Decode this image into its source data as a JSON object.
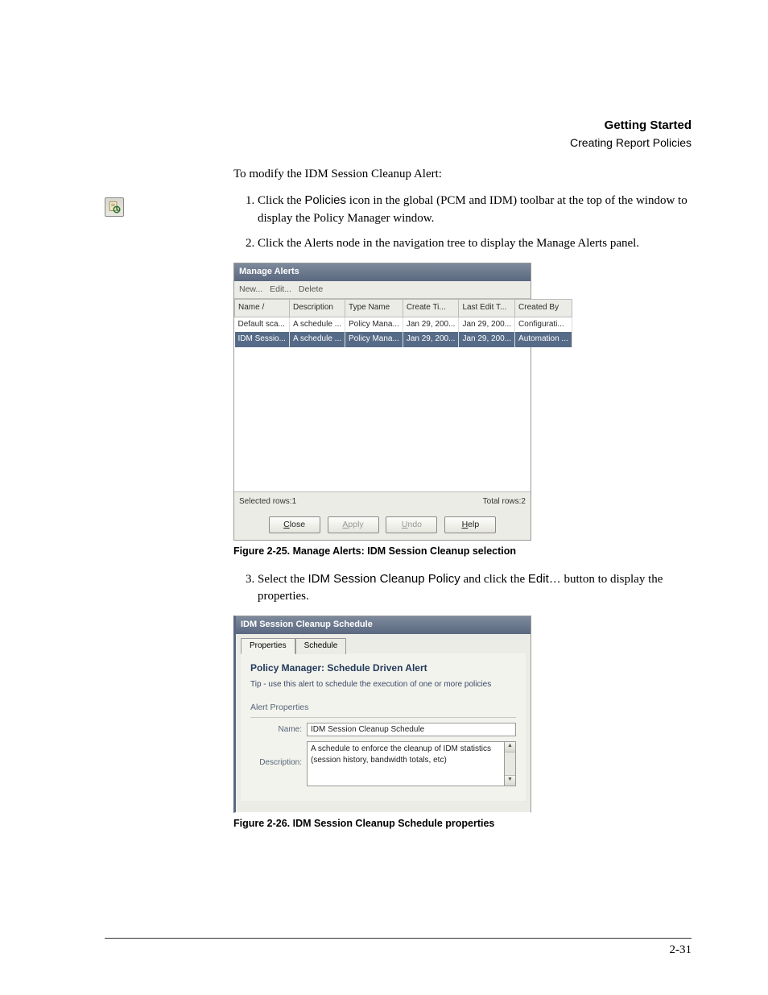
{
  "header": {
    "title": "Getting Started",
    "subtitle": "Creating Report Policies"
  },
  "intro": "To modify the IDM Session Cleanup Alert:",
  "step1_pre": "Click the ",
  "step1_term": "Policies",
  "step1_post": " icon in the global (PCM and IDM) toolbar at the top of the window to display the Policy Manager window.",
  "step2": "Click the Alerts node in the navigation tree to display the Manage Alerts panel.",
  "manage_alerts": {
    "title": "Manage Alerts",
    "menu": [
      "New...",
      "Edit...",
      "Delete"
    ],
    "headers": [
      "Name  /",
      "Description",
      "Type Name",
      "Create Ti...",
      "Last Edit T...",
      "Created By"
    ],
    "rows": [
      [
        "Default sca...",
        "A schedule ...",
        "Policy Mana...",
        "Jan 29, 200...",
        "Jan 29, 200...",
        "Configurati..."
      ],
      [
        "IDM Sessio...",
        "A schedule ...",
        "Policy Mana...",
        "Jan 29, 200...",
        "Jan 29, 200...",
        "Automation ..."
      ]
    ],
    "selected_rows": "Selected rows:1",
    "total_rows": "Total rows:2",
    "buttons": {
      "close": "Close",
      "apply": "Apply",
      "undo": "Undo",
      "help": "Help"
    }
  },
  "fig1_caption": "Figure 2-25. Manage Alerts: IDM Session Cleanup selection",
  "step3_pre": "Select the ",
  "step3_term": "IDM Session Cleanup Policy",
  "step3_mid": " and click the ",
  "step3_btn": "Edit…",
  "step3_post": " button to display the properties.",
  "schedule_dialog": {
    "title": "IDM Session Cleanup Schedule",
    "tabs": {
      "properties": "Properties",
      "schedule": "Schedule"
    },
    "heading": "Policy Manager: Schedule Driven Alert",
    "tip": "Tip - use this alert to schedule the execution of one or more policies",
    "section": "Alert Properties",
    "name_label": "Name:",
    "name_value": "IDM Session Cleanup Schedule",
    "desc_label": "Description:",
    "desc_value": "A schedule to enforce the cleanup of IDM statistics (session history, bandwidth totals, etc)"
  },
  "fig2_caption": "Figure 2-26. IDM Session Cleanup Schedule properties",
  "page_number": "2-31"
}
